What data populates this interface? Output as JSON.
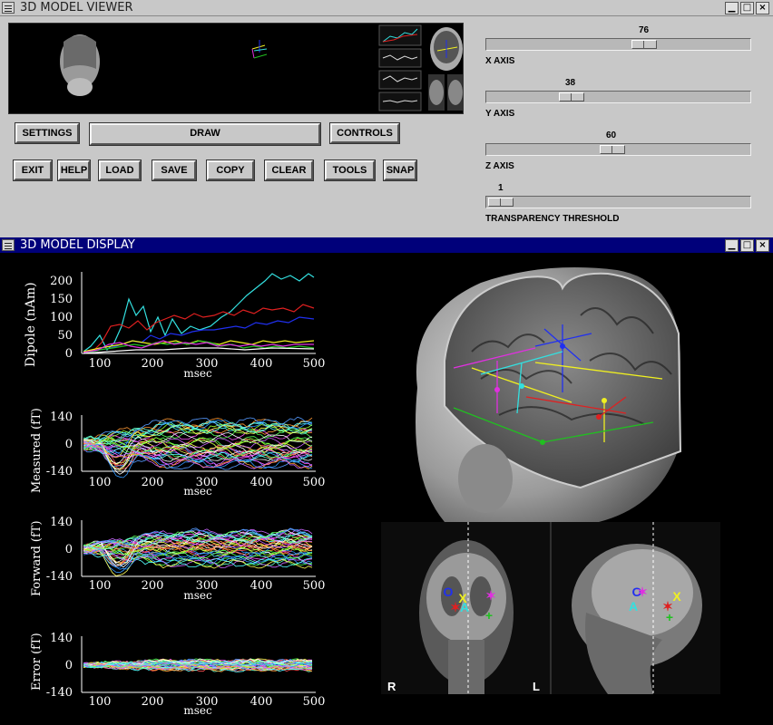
{
  "viewer": {
    "title": "3D MODEL VIEWER",
    "buttons": {
      "settings": "SETTINGS",
      "draw": "DRAW",
      "controls": "CONTROLS",
      "exit": "EXIT",
      "help": "HELP",
      "load": "LOAD",
      "save": "SAVE",
      "copy": "COPY",
      "clear": "CLEAR",
      "tools": "TOOLS",
      "snap": "SNAP"
    },
    "sliders": [
      {
        "label": "X AXIS",
        "value": "76",
        "fraction": 0.64
      },
      {
        "label": "Y AXIS",
        "value": "38",
        "fraction": 0.32
      },
      {
        "label": "Z AXIS",
        "value": "60",
        "fraction": 0.5
      },
      {
        "label": "TRANSPARENCY THRESHOLD",
        "value": "1",
        "fraction": 0.02
      }
    ]
  },
  "display": {
    "title": "3D MODEL DISPLAY",
    "plots": [
      {
        "ylabel": "Dipole (nAm)",
        "xlabel": "msec",
        "yticks": [
          "200",
          "150",
          "100",
          "50",
          "0"
        ],
        "xticks": [
          "100",
          "200",
          "300",
          "400",
          "500"
        ]
      },
      {
        "ylabel": "Measured (fT)",
        "xlabel": "msec",
        "yticks": [
          "140",
          "0",
          "-140"
        ],
        "xticks": [
          "100",
          "200",
          "300",
          "400",
          "500"
        ]
      },
      {
        "ylabel": "Forward (fT)",
        "xlabel": "msec",
        "yticks": [
          "140",
          "0",
          "-140"
        ],
        "xticks": [
          "100",
          "200",
          "300",
          "400",
          "500"
        ]
      },
      {
        "ylabel": "Error (fT)",
        "xlabel": "msec",
        "yticks": [
          "140",
          "0",
          "-140"
        ],
        "xticks": [
          "100",
          "200",
          "300",
          "400",
          "500"
        ]
      }
    ],
    "slice_labels": {
      "left": "R",
      "right": "L"
    },
    "marker_symbols": {
      "o": "O",
      "x": "X",
      "a": "A",
      "star": "✶",
      "plus": "+"
    },
    "colors": {
      "cyan": "#33e0e0",
      "red": "#e02020",
      "blue": "#2030f0",
      "yellow": "#f0f020",
      "green": "#20c020",
      "magenta": "#e030e0"
    }
  },
  "window_controls": {
    "minimize": "▁",
    "maximize": "□",
    "close": "×"
  }
}
